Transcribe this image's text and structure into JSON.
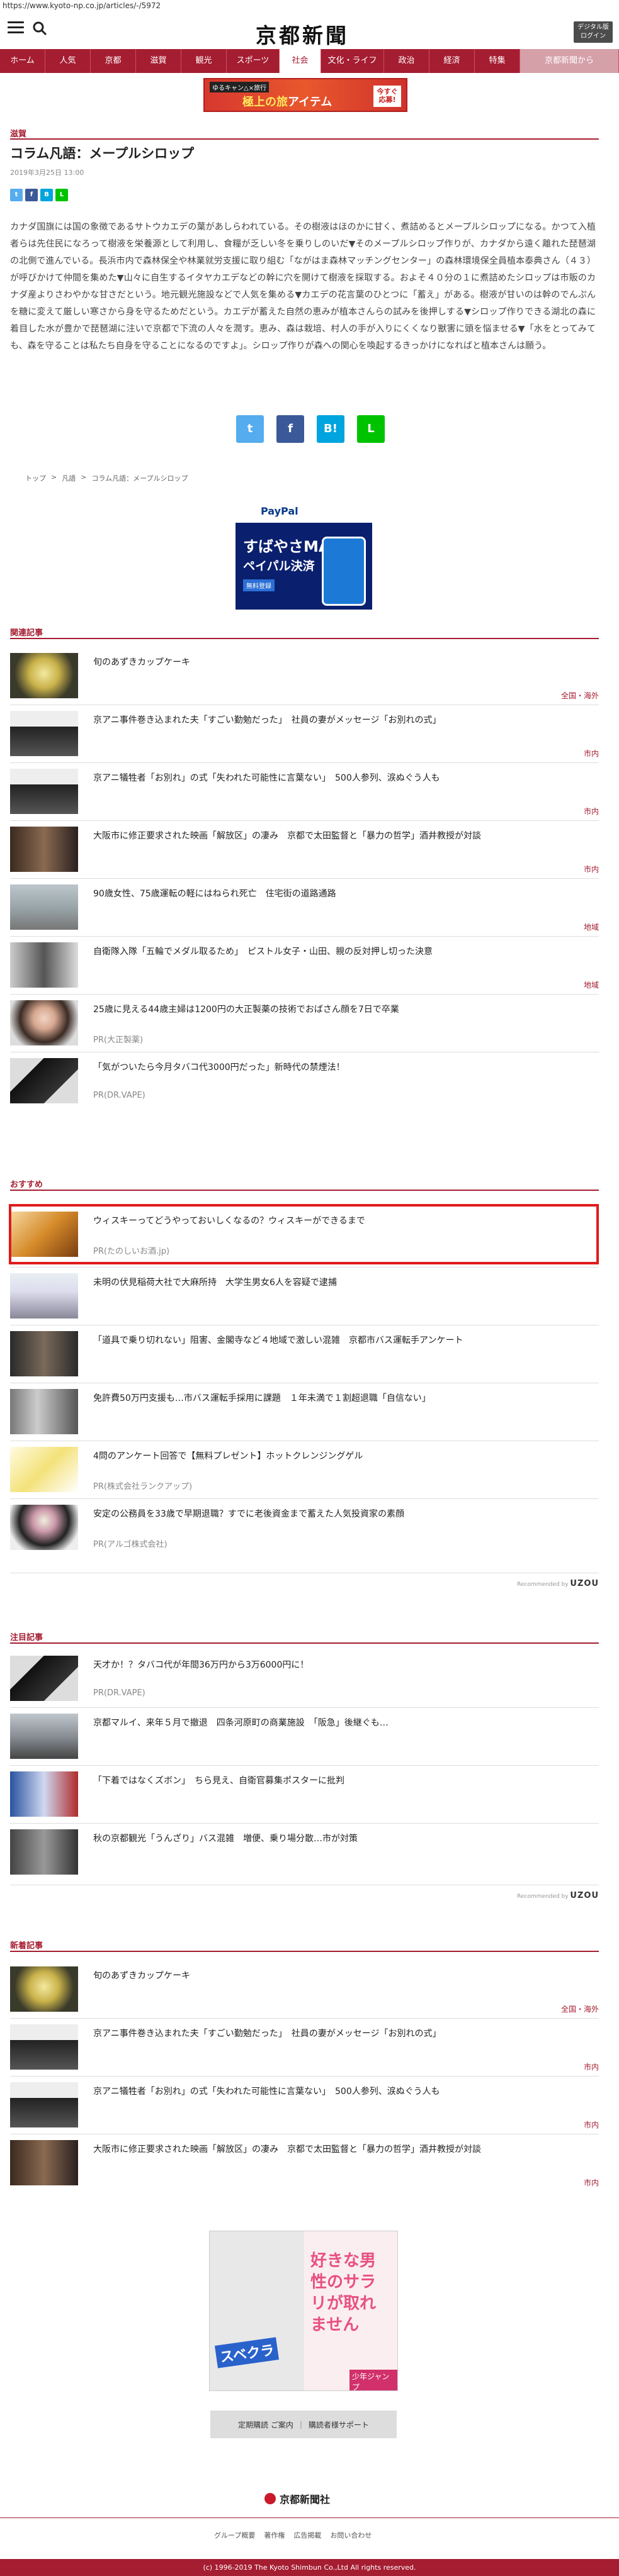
{
  "url": "https://www.kyoto-np.co.jp/articles/-/5972",
  "header": {
    "logo": "京都新聞",
    "login_line1": "デジタル版",
    "login_line2": "ログイン"
  },
  "nav": [
    "ホーム",
    "人気",
    "京都",
    "滋賀",
    "観光",
    "スポーツ",
    "社会",
    "文化・ライフ",
    "政治",
    "経済",
    "特集",
    "京都新聞から"
  ],
  "top_banner": {
    "tag": "ゆるキャン△×旅行",
    "main": "極上の旅",
    "item": "アイテム",
    "cta": "今すぐ 応募!"
  },
  "article": {
    "category": "滋賀",
    "title": "コラム凡語：メープルシロップ",
    "date": "2019年3月25日 13:00",
    "body": "カナダ国旗には国の象徴であるサトウカエデの葉があしらわれている。その樹液はほのかに甘く、煮詰めるとメープルシロップになる。かつて入植者らは先住民になろって樹液を栄養源として利用し、食糧が乏しい冬を乗りしのいだ▼そのメープルシロップ作りが、カナダから遠く離れた琵琶湖の北側で進んでいる。長浜市内で森林保全や林業就労支援に取り組む「ながはま森林マッチングセンター」の森林環境保全員植本泰典さん（４３）が呼びかけて仲間を集めた▼山々に自生するイタヤカエデなどの幹に穴を開けて樹液を採取する。およそ４０分の１に煮詰めたシロップは市販のカナダ産よりさわやかな甘さだという。地元観光施設などで人気を集める▼カエデの花言葉のひとつに「蓄え」がある。樹液が甘いのは幹のでんぷんを糖に変えて厳しい寒さから身を守るためだという。カエデが蓄えた自然の恵みが植本さんらの試みを後押しする▼シロップ作りできる湖北の森に着目した水が豊かで琵琶湖に注いで京都で下流の人々を潤す。恵み、森は栽培、村人の手が入りにくくなり獣害に頭を悩ませる▼「水をとってみても、森を守ることは私たち自身を守ることになるのですよ」。シロップ作りが森への関心を喚起するきっかけになればと植本さんは願う。"
  },
  "breadcrumb": [
    "トップ",
    "凡語",
    "コラム凡語：メープルシロップ"
  ],
  "ad_paypal": {
    "brand": "PayPal",
    "line1": "すばやさMAX",
    "line2": "ペイパル決済",
    "line3": "無料登録"
  },
  "sections": {
    "related": "関連記事",
    "recommended": "おすすめ",
    "featured": "注目記事",
    "latest": "新着記事"
  },
  "related": [
    {
      "title": "旬のあずきカップケーキ",
      "tag": "全国・海外"
    },
    {
      "title": "京アニ事件巻き込まれた夫「すごい勤勉だった」　社員の妻がメッセージ「お別れの式」",
      "tag": "市内"
    },
    {
      "title": "京アニ犠牲者「お別れ」の式「失われた可能性に言葉ない」　500人参列、涙ぬぐう人も",
      "tag": "市内"
    },
    {
      "title": "大阪市に修正要求された映画「解放区」の凄み　京都で太田監督と「暴力の哲学」酒井教授が対談",
      "tag": "市内"
    },
    {
      "title": "90歳女性、75歳運転の軽にはねられ死亡　住宅街の道路通路",
      "tag": "地域"
    },
    {
      "title": "自衛隊入隊「五輪でメダル取るため」　ピストル女子・山田、親の反対押し切った決意",
      "tag": "地域"
    },
    {
      "title": "25歳に見える44歳主婦は1200円の大正製薬の技術でおばさん顔を7日で卒業",
      "pr": "PR(大正製薬)"
    },
    {
      "title": "「気がついたら今月タバコ代3000円だった」新時代の禁煙法！",
      "pr": "PR(DR.VAPE)"
    }
  ],
  "recommended": [
    {
      "title": "ウィスキーってどうやっておいしくなるの？ウィスキーができるまで",
      "pr": "PR(たのしいお酒.jp)"
    },
    {
      "title": "未明の伏見稲荷大社で大麻所持　大学生男女6人を容疑で逮捕"
    },
    {
      "title": "「道具で乗り切れない」阻害、金閣寺など４地域で激しい混雑　京都市バス運転手アンケート"
    },
    {
      "title": "免許費50万円支援も…市バス運転手採用に課題　１年未満で１割超退職「自信ない」"
    },
    {
      "title": "4問のアンケート回答で【無料プレゼント】ホットクレンジングゲル",
      "pr": "PR(株式会社ランクアップ)"
    },
    {
      "title": "安定の公務員を33歳で早期退職？すでに老後資金まで蓄えた人気投資家の素顔",
      "pr": "PR(アルゴ株式会社)"
    }
  ],
  "recommended_by": "Recommended by",
  "recommended_brand": "UZOU",
  "featured": [
    {
      "title": "天才か！？タバコ代が年間36万円から3万6000円に！",
      "pr": "PR(DR.VAPE)"
    },
    {
      "title": "京都マルイ、来年５月で撤退　四条河原町の商業施設　「阪急」後継ぐも…"
    },
    {
      "title": "「下着ではなくズボン」　ちら見え、自衛官募集ポスターに批判"
    },
    {
      "title": "秋の京都観光「うんざり」バス混雑　増便、乗り場分散…市が対策"
    }
  ],
  "latest": [
    {
      "title": "旬のあずきカップケーキ",
      "tag": "全国・海外"
    },
    {
      "title": "京アニ事件巻き込まれた夫「すごい勤勉だった」　社員の妻がメッセージ「お別れの式」",
      "tag": "市内"
    },
    {
      "title": "京アニ犠牲者「お別れ」の式「失われた可能性に言葉ない」　500人参列、涙ぬぐう人も",
      "tag": "市内"
    },
    {
      "title": "大阪市に修正要求された映画「解放区」の凄み　京都で太田監督と「暴力の哲学」酒井教授が対談",
      "tag": "市内"
    }
  ],
  "ad_manga": {
    "right_text": "好きな男性のサラリが取れません",
    "left_text": "スベクラ",
    "badge": "少年ジャンプ"
  },
  "footer": {
    "btn1": "定期購読 ご案内",
    "btn2": "購読者様サポート",
    "company": "京都新聞社",
    "links": [
      "グループ概要",
      "著作権",
      "広告掲載",
      "お問い合わせ"
    ],
    "copyright": "(c) 1996-2019 The Kyoto Shimbun Co.,Ltd All rights reserved."
  }
}
